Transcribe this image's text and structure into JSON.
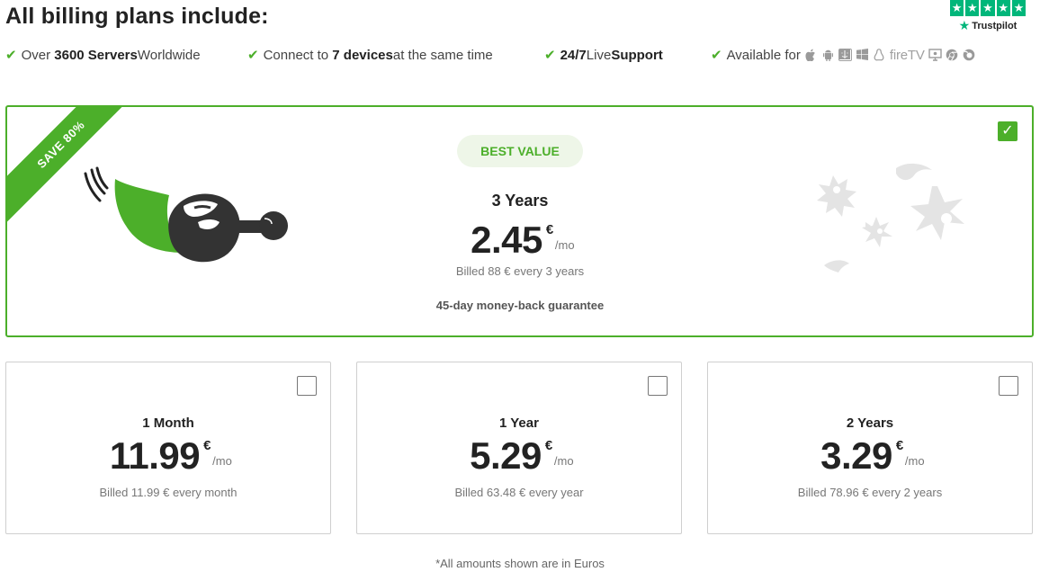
{
  "header": {
    "title": "All billing plans include:",
    "trustpilot_label": "Trustpilot"
  },
  "features": [
    {
      "pre": "Over ",
      "bold": "3600 Servers",
      "post": " Worldwide"
    },
    {
      "pre": "Connect to ",
      "bold": "7 devices",
      "post": " at the same time"
    },
    {
      "pre": "",
      "bold": "24/7",
      "post": " Live ",
      "bold2": "Support"
    },
    {
      "pre": "Available for",
      "bold": "",
      "post": ""
    }
  ],
  "platforms": {
    "icons": [
      "apple-icon",
      "android-icon",
      "finder-icon",
      "windows-icon",
      "linux-icon",
      "firetv-icon",
      "tv-icon",
      "chrome-icon",
      "firefox-icon"
    ],
    "firetv_text": "fireTV"
  },
  "featured_plan": {
    "ribbon": "SAVE 80%",
    "badge": "BEST VALUE",
    "name": "3 Years",
    "price": "2.45",
    "currency": "€",
    "period": "/mo",
    "billed": "Billed 88 € every 3 years",
    "guarantee": "45-day money-back guarantee",
    "selected": true
  },
  "plans": [
    {
      "name": "1 Month",
      "price": "11.99",
      "currency": "€",
      "period": "/mo",
      "billed": "Billed 11.99 € every month",
      "selected": false
    },
    {
      "name": "1 Year",
      "price": "5.29",
      "currency": "€",
      "period": "/mo",
      "billed": "Billed 63.48 € every year",
      "selected": false
    },
    {
      "name": "2 Years",
      "price": "3.29",
      "currency": "€",
      "period": "/mo",
      "billed": "Billed 78.96 € every 2 years",
      "selected": false
    }
  ],
  "footnote": "*All amounts shown are in Euros",
  "colors": {
    "accent": "#4caf2a",
    "trustpilot": "#00b67a",
    "border": "#cfcfcf"
  }
}
